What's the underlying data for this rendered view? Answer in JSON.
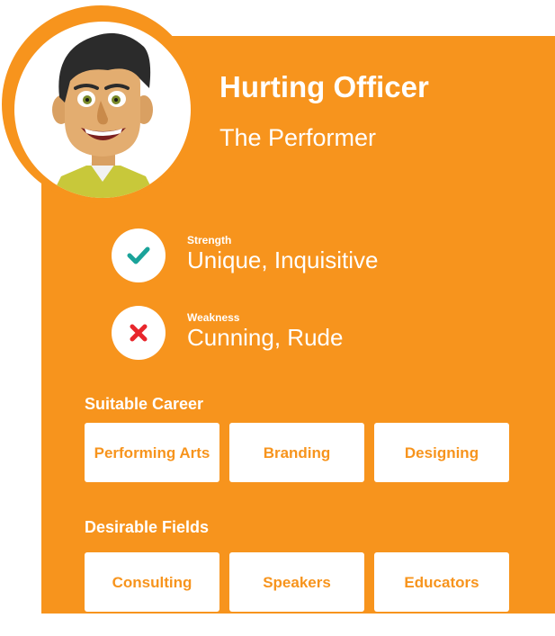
{
  "profile": {
    "name": "Hurting Officer",
    "type": "The Performer",
    "avatar_icon": "cartoon-man-avatar"
  },
  "strength": {
    "caption": "Strength",
    "value": "Unique, Inquisitive",
    "icon": "check-icon",
    "icon_color": "#1aa39a"
  },
  "weakness": {
    "caption": "Weakness",
    "value": "Cunning, Rude",
    "icon": "cross-icon",
    "icon_color": "#e8262c"
  },
  "careers": {
    "heading": "Suitable Career",
    "items": [
      "Performing Arts",
      "Branding",
      "Designing"
    ]
  },
  "fields": {
    "heading": "Desirable Fields",
    "items": [
      "Consulting",
      "Speakers",
      "Educators"
    ]
  },
  "colors": {
    "accent": "#f7941d",
    "text_on_accent": "#ffffff"
  }
}
